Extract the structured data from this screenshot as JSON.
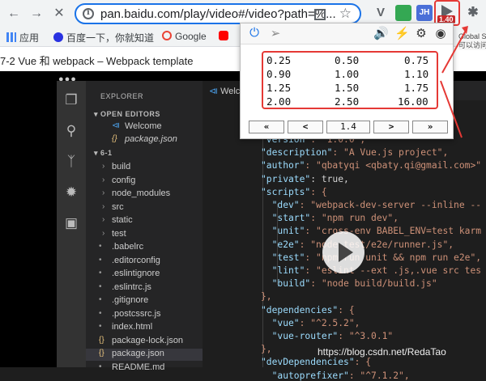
{
  "browser": {
    "url": "pan.baidu.com/play/video#/video?path=%...",
    "bookmarks": [
      {
        "label": "应用",
        "color": "#4285f4"
      },
      {
        "label": "百度一下，你就知道",
        "color": "#2932e1"
      },
      {
        "label": "Google",
        "color": "#ea4335"
      }
    ],
    "extensions": [
      {
        "name": "v-icon",
        "label": "V",
        "color": "#5f6368"
      },
      {
        "name": "grid-icon",
        "label": "",
        "color": "#34a853"
      },
      {
        "name": "jh-icon",
        "label": "JH",
        "color": "#4a6fd8"
      }
    ]
  },
  "page": {
    "title": "7-2 Vue 和 webpack – Webpack template"
  },
  "speed_popup": {
    "badge": "1.40",
    "tooltip_lines": [
      "Global Sp",
      "可以访问"
    ],
    "speeds": [
      [
        "0.25",
        "0.50",
        "0.75"
      ],
      [
        "0.90",
        "1.00",
        "1.10"
      ],
      [
        "1.25",
        "1.50",
        "1.75"
      ],
      [
        "2.00",
        "2.50",
        "16.00"
      ]
    ],
    "controls": {
      "rewind": "«",
      "prev": "<",
      "current": "1.4",
      "next": ">",
      "forward": "»"
    }
  },
  "vscode": {
    "explorer_title": "EXPLORER",
    "open_editors": "OPEN EDITORS",
    "open_files": [
      "Welcome",
      "package.json"
    ],
    "folder": "6-1",
    "tree": [
      {
        "label": "build",
        "type": "folder"
      },
      {
        "label": "config",
        "type": "folder"
      },
      {
        "label": "node_modules",
        "type": "folder"
      },
      {
        "label": "src",
        "type": "folder"
      },
      {
        "label": "static",
        "type": "folder"
      },
      {
        "label": "test",
        "type": "folder"
      },
      {
        "label": ".babelrc",
        "type": "file"
      },
      {
        "label": ".editorconfig",
        "type": "file"
      },
      {
        "label": ".eslintignore",
        "type": "file"
      },
      {
        "label": ".eslintrc.js",
        "type": "file"
      },
      {
        "label": ".gitignore",
        "type": "file"
      },
      {
        "label": ".postcssrc.js",
        "type": "file"
      },
      {
        "label": "index.html",
        "type": "file"
      },
      {
        "label": "package-lock.json",
        "type": "file"
      },
      {
        "label": "package.json",
        "type": "file"
      },
      {
        "label": "README.md",
        "type": "file"
      }
    ],
    "tab": "Welc",
    "code_lines": [
      {
        "k": "\"version\"",
        "v": ": \"1.0.0\","
      },
      {
        "k": "\"description\"",
        "v": ": \"A Vue.js project\","
      },
      {
        "k": "\"author\"",
        "v": ": \"qbatyqi <qbaty.qi@gmail.com>\""
      },
      {
        "k": "\"private\"",
        "v": ": true,"
      },
      {
        "k": "\"scripts\"",
        "v": ": {"
      },
      {
        "k": "  \"dev\"",
        "v": ": \"webpack-dev-server --inline --"
      },
      {
        "k": "  \"start\"",
        "v": ": \"npm run dev\","
      },
      {
        "k": "  \"unit\"",
        "v": ": \"cross-env BABEL_ENV=test karm"
      },
      {
        "k": "  \"e2e\"",
        "v": ": \"node test/e2e/runner.js\","
      },
      {
        "k": "  \"test\"",
        "v": ": \"npm run unit && npm run e2e\","
      },
      {
        "k": "  \"lint\"",
        "v": ": \"eslint --ext .js,.vue src tes"
      },
      {
        "k": "  \"build\"",
        "v": ": \"node build/build.js\""
      },
      {
        "k": "",
        "v": "},"
      },
      {
        "k": "\"dependencies\"",
        "v": ": {"
      },
      {
        "k": "  \"vue\"",
        "v": ": \"^2.5.2\","
      },
      {
        "k": "  \"vue-router\"",
        "v": ": \"^3.0.1\""
      },
      {
        "k": "",
        "v": "},"
      },
      {
        "k": "\"devDependencies\"",
        "v": ": {"
      },
      {
        "k": "  \"autoprefixer\"",
        "v": ": \"^7.1.2\","
      }
    ]
  },
  "watermark": "https://blog.csdn.net/RedaTao"
}
